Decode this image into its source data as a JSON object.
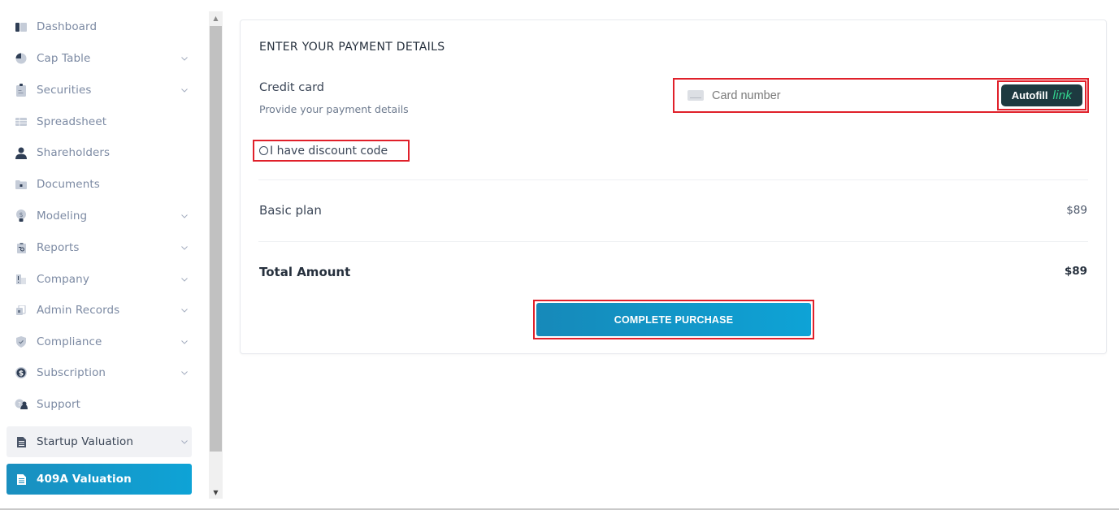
{
  "sidebar": {
    "items": [
      {
        "label": "Dashboard",
        "icon": "dashboard-icon",
        "expandable": false
      },
      {
        "label": "Cap Table",
        "icon": "pie-chart-icon",
        "expandable": true
      },
      {
        "label": "Securities",
        "icon": "clipboard-icon",
        "expandable": true
      },
      {
        "label": "Spreadsheet",
        "icon": "spreadsheet-icon",
        "expandable": false
      },
      {
        "label": "Shareholders",
        "icon": "user-icon",
        "expandable": false
      },
      {
        "label": "Documents",
        "icon": "folder-lock-icon",
        "expandable": false
      },
      {
        "label": "Modeling",
        "icon": "lightbulb-dollar-icon",
        "expandable": true
      },
      {
        "label": "Reports",
        "icon": "report-icon",
        "expandable": true
      },
      {
        "label": "Company",
        "icon": "building-icon",
        "expandable": true
      },
      {
        "label": "Admin Records",
        "icon": "records-icon",
        "expandable": true
      },
      {
        "label": "Compliance",
        "icon": "shield-check-icon",
        "expandable": true
      },
      {
        "label": "Subscription",
        "icon": "dollar-circle-icon",
        "expandable": true
      },
      {
        "label": "Support",
        "icon": "support-chat-icon",
        "expandable": false
      },
      {
        "label": "Startup Valuation",
        "icon": "document-icon",
        "expandable": true
      },
      {
        "label": "409A Valuation",
        "icon": "document-icon",
        "expandable": false,
        "active": true
      }
    ]
  },
  "payment": {
    "title": "ENTER YOUR PAYMENT DETAILS",
    "credit_card_label": "Credit card",
    "credit_card_sub": "Provide your payment details",
    "card_number_placeholder": "Card number",
    "card_number_value": "",
    "autofill_label": "Autofill",
    "link_label": "link",
    "discount_label": "I have discount code",
    "discount_checked": false
  },
  "summary": {
    "plan_label": "Basic plan",
    "plan_price": "$89",
    "total_label": "Total Amount",
    "total_price": "$89"
  },
  "actions": {
    "complete_purchase_label": "COMPLETE PURCHASE"
  },
  "colors": {
    "accent": "#0ea3d6",
    "highlight_border": "#e0202a",
    "link_brand": "#33d58f",
    "link_bg": "#1d3a40"
  }
}
